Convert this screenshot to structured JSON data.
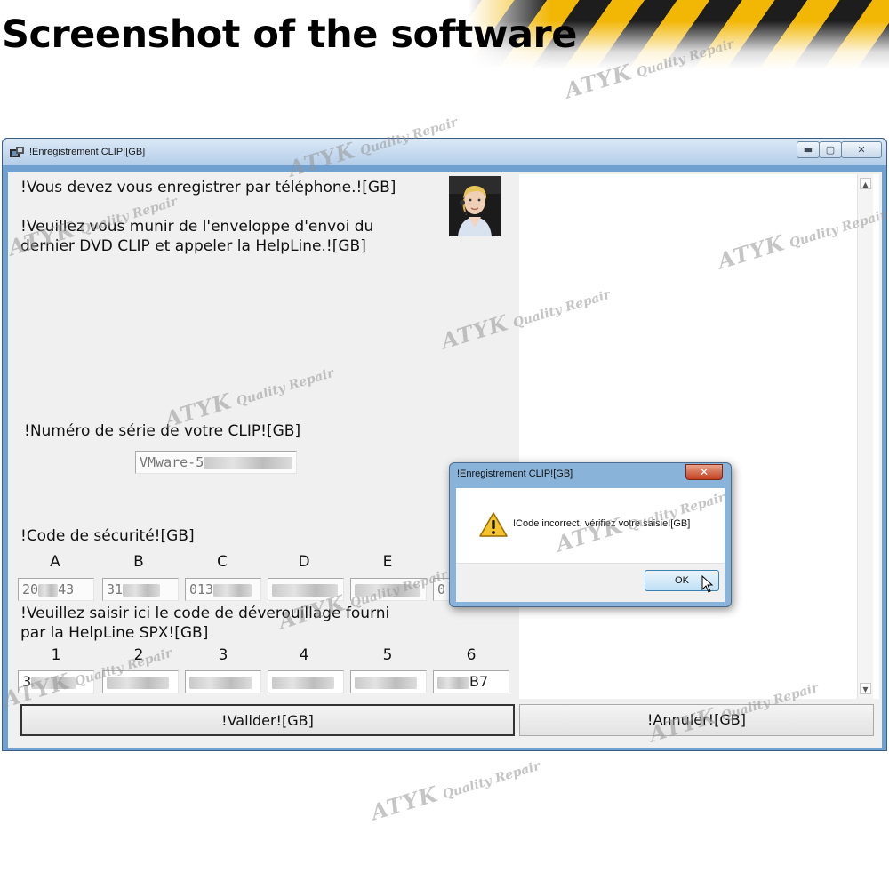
{
  "banner": {
    "title": "Screenshot of the software"
  },
  "main_window": {
    "title": "!Enregistrement CLIP![GB]",
    "controls": {
      "minimize": "▬",
      "maximize": "▢",
      "close": "✕"
    },
    "intro_line1": "!Vous devez vous enregistrer par téléphone.![GB]",
    "intro_line2": "!Veuillez vous munir de l'enveloppe d'envoi du",
    "intro_line3": "dernier DVD CLIP et appeler la HelpLine.![GB]",
    "serial": {
      "label": "!Numéro de série de votre CLIP![GB]",
      "value": "VMware-5"
    },
    "security": {
      "label": "!Code de sécurité![GB]",
      "columns": [
        "A",
        "B",
        "C",
        "D",
        "E"
      ],
      "values": [
        "20",
        "31",
        "013",
        "",
        "",
        "0"
      ],
      "value_suffixes": [
        "43",
        "",
        "",
        "",
        "",
        ""
      ]
    },
    "unlock": {
      "label_line1": "!Veuillez saisir ici le code de déverouillage fourni",
      "label_line2": "par la HelpLine SPX![GB]",
      "columns": [
        "1",
        "2",
        "3",
        "4",
        "5",
        "6"
      ],
      "values": [
        "3",
        "",
        "",
        "",
        "",
        ""
      ],
      "value_suffixes": [
        "",
        "",
        "",
        "",
        "",
        "B7"
      ]
    },
    "valider_label": "!Valider![GB]",
    "annuler_label": "!Annuler![GB]"
  },
  "dialog": {
    "title": "!Enregistrement CLIP![GB]",
    "close": "✕",
    "icon": "warning-icon",
    "message": "!Code incorrect, vérifiez votre saisie![GB]",
    "ok_label": "OK"
  },
  "watermark": {
    "brand": "ATYK",
    "tagline": "Quality Repair"
  }
}
